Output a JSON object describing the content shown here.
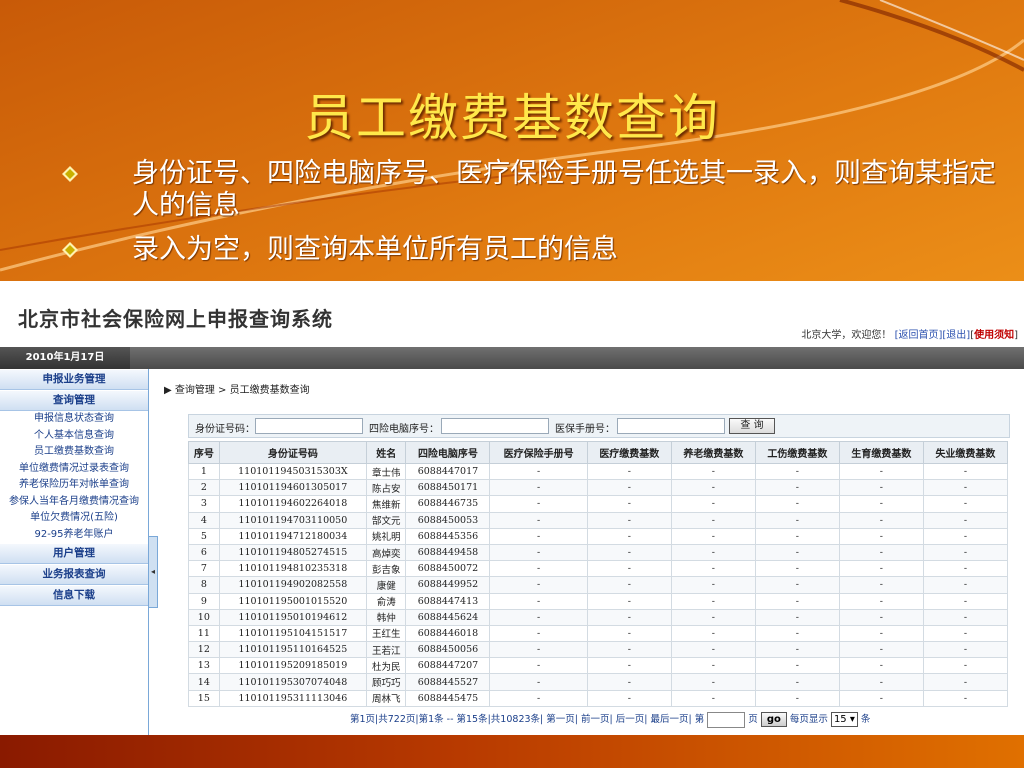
{
  "slide": {
    "title": "员工缴费基数查询",
    "bullets": [
      "身份证号、四险电脑序号、医疗保险手册号任选其一录入，则查询某指定人的信息",
      "录入为空，则查询本单位所有员工的信息"
    ]
  },
  "app": {
    "logo": "北京市社会保险网上申报查询系统",
    "user": "北京大学，欢迎您！",
    "links": {
      "home": "[返回首页]",
      "logout": "[退出]",
      "manual_open": "[",
      "manual": "使用须知",
      "manual_close": "]"
    },
    "date": "2010年1月17日",
    "sidebar": {
      "sections": [
        "申报业务管理",
        "查询管理"
      ],
      "items": [
        "申报信息状态查询",
        "个人基本信息查询",
        "员工缴费基数查询",
        "单位缴费情况过录表查询",
        "养老保险历年对帐单查询",
        "参保人当年各月缴费情况查询",
        "单位欠费情况(五险)",
        "92-95养老年账户"
      ],
      "sections2": [
        "用户管理",
        "业务报表查询",
        "信息下载"
      ]
    },
    "breadcrumb": "查询管理 > 员工缴费基数查询",
    "search": {
      "id_label": "身份证号码：",
      "pc_label": "四险电脑序号：",
      "book_label": "医保手册号：",
      "button": "查 询"
    },
    "table": {
      "headers": [
        "序号",
        "身份证号码",
        "姓名",
        "四险电脑序号",
        "医疗保险手册号",
        "医疗缴费基数",
        "养老缴费基数",
        "工伤缴费基数",
        "生育缴费基数",
        "失业缴费基数"
      ],
      "rows": [
        [
          "1",
          "11010119450315303X",
          "章士伟",
          "6088447017",
          "-",
          "-",
          "-",
          "-",
          "-",
          "-"
        ],
        [
          "2",
          "110101194601305017",
          "陈占安",
          "6088450171",
          "-",
          "-",
          "-",
          "-",
          "-",
          "-"
        ],
        [
          "3",
          "110101194602264018",
          "焦维新",
          "6088446735",
          "-",
          "-",
          "-",
          "-",
          "-",
          "-"
        ],
        [
          "4",
          "110101194703110050",
          "郜文元",
          "6088450053",
          "-",
          "-",
          "-",
          "-",
          "-",
          "-"
        ],
        [
          "5",
          "110101194712180034",
          "姚礼明",
          "6088445356",
          "-",
          "-",
          "-",
          "-",
          "-",
          "-"
        ],
        [
          "6",
          "110101194805274515",
          "高焯奕",
          "6088449458",
          "-",
          "-",
          "-",
          "-",
          "-",
          "-"
        ],
        [
          "7",
          "110101194810235318",
          "彭吉象",
          "6088450072",
          "-",
          "-",
          "-",
          "-",
          "-",
          "-"
        ],
        [
          "8",
          "110101194902082558",
          "康健",
          "6088449952",
          "-",
          "-",
          "-",
          "-",
          "-",
          "-"
        ],
        [
          "9",
          "110101195001015520",
          "俞涛",
          "6088447413",
          "-",
          "-",
          "-",
          "-",
          "-",
          "-"
        ],
        [
          "10",
          "110101195010194612",
          "韩仲",
          "6088445624",
          "-",
          "-",
          "-",
          "-",
          "-",
          "-"
        ],
        [
          "11",
          "110101195104151517",
          "王红生",
          "6088446018",
          "-",
          "-",
          "-",
          "-",
          "-",
          "-"
        ],
        [
          "12",
          "110101195110164525",
          "王若江",
          "6088450056",
          "-",
          "-",
          "-",
          "-",
          "-",
          "-"
        ],
        [
          "13",
          "110101195209185019",
          "杜为民",
          "6088447207",
          "-",
          "-",
          "-",
          "-",
          "-",
          "-"
        ],
        [
          "14",
          "110101195307074048",
          "顾巧巧",
          "6088445527",
          "-",
          "-",
          "-",
          "-",
          "-",
          "-"
        ],
        [
          "15",
          "110101195311113046",
          "周林飞",
          "6088445475",
          "-",
          "-",
          "-",
          "-",
          "-",
          "-"
        ]
      ]
    },
    "pager": {
      "summary": "第1页|共722页|第1条 -- 第15条|共10823条|",
      "first": "第一页|",
      "prev": "前一页|",
      "next": "后一页|",
      "last": "最后一页|",
      "page_prefix": "第",
      "page_suffix": "页",
      "go": "go",
      "per_page_label": "每页显示",
      "per_page": "15",
      "per_page_suffix": "条"
    }
  },
  "colors": {
    "accent_orange": "#e07a10",
    "title_yellow": "#ffe84a",
    "link_blue": "#2a4fae"
  }
}
